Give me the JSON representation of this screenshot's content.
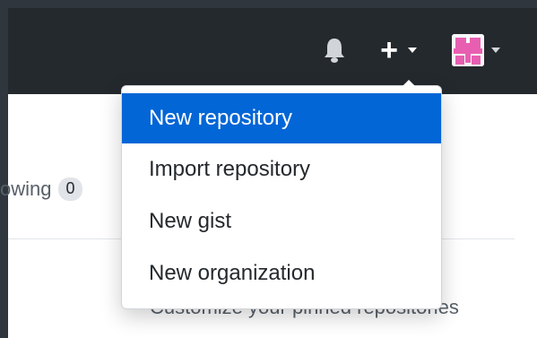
{
  "header": {
    "icons": {
      "notifications": "bell-icon",
      "create": "plus-icon",
      "avatar": "avatar-icon"
    }
  },
  "create_menu": {
    "items": [
      {
        "label": "New repository",
        "active": true
      },
      {
        "label": "Import repository",
        "active": false
      },
      {
        "label": "New gist",
        "active": false
      },
      {
        "label": "New organization",
        "active": false
      }
    ]
  },
  "profile": {
    "following_label": "owing",
    "following_count": "0",
    "customize_text": "Customize your pinned repositories"
  },
  "colors": {
    "header_bg": "#24292e",
    "accent": "#0366d6",
    "menu_text": "#24292e",
    "avatar_pink": "#e85fb1"
  }
}
